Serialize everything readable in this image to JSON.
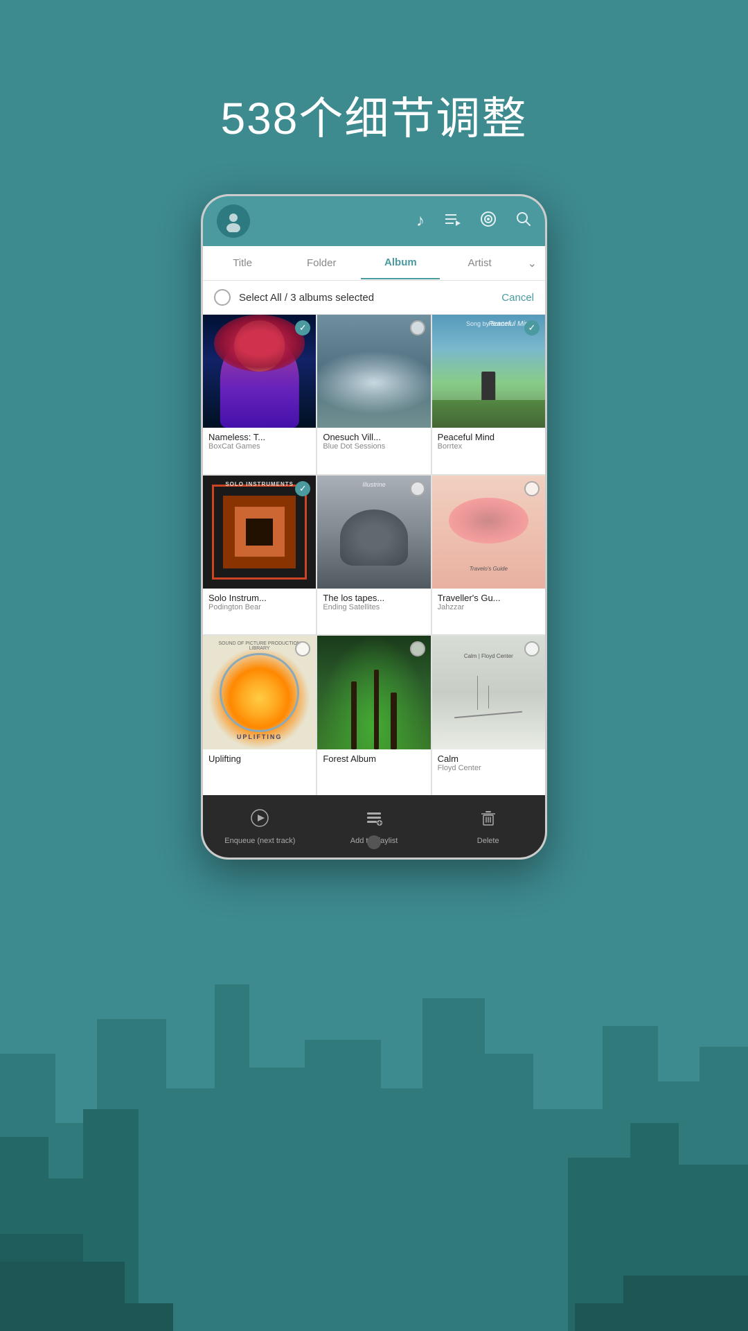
{
  "page": {
    "title": "538个细节调整",
    "background_color": "#3d8a8f"
  },
  "nav": {
    "tabs": [
      {
        "id": "title",
        "label": "Title",
        "active": false
      },
      {
        "id": "folder",
        "label": "Folder",
        "active": false
      },
      {
        "id": "album",
        "label": "Album",
        "active": true
      },
      {
        "id": "artist",
        "label": "Artist",
        "active": false
      }
    ]
  },
  "selection": {
    "select_all_label": "Select All",
    "separator": "/",
    "selected_text": "3 albums selected",
    "cancel_label": "Cancel"
  },
  "albums": [
    {
      "id": 1,
      "name": "Nameless: T...",
      "artist": "BoxCat Games",
      "art_class": "art-1",
      "checked": true
    },
    {
      "id": 2,
      "name": "Onesuch Vill...",
      "artist": "Blue Dot Sessions",
      "art_class": "art-2",
      "checked": false
    },
    {
      "id": 3,
      "name": "Peaceful Mind",
      "artist": "Borrtex",
      "art_class": "art-3",
      "checked": true
    },
    {
      "id": 4,
      "name": "Solo Instrum...",
      "artist": "Podington Bear",
      "art_class": "art-4",
      "checked": true
    },
    {
      "id": 5,
      "name": "The los tapes...",
      "artist": "Ending Satellites",
      "art_class": "art-5",
      "checked": false
    },
    {
      "id": 6,
      "name": "Traveller's Gu...",
      "artist": "Jahzzar",
      "art_class": "art-6",
      "checked": false
    },
    {
      "id": 7,
      "name": "Uplifting",
      "artist": "",
      "art_class": "art-7",
      "checked": false
    },
    {
      "id": 8,
      "name": "Forest Album",
      "artist": "",
      "art_class": "art-8",
      "checked": false
    },
    {
      "id": 9,
      "name": "Calm",
      "artist": "Floyd Center",
      "art_class": "art-9",
      "checked": false
    }
  ],
  "actions": [
    {
      "id": "enqueue",
      "label": "Enqueue (next track)",
      "icon": "▶"
    },
    {
      "id": "playlist",
      "label": "Add to playlist",
      "icon": "☰"
    },
    {
      "id": "delete",
      "label": "Delete",
      "icon": "🗑"
    }
  ],
  "icons": {
    "music_note": "♪",
    "queue": "≡",
    "disc": "◎",
    "search": "🔍",
    "check": "✓",
    "chevron_down": "⌄"
  }
}
